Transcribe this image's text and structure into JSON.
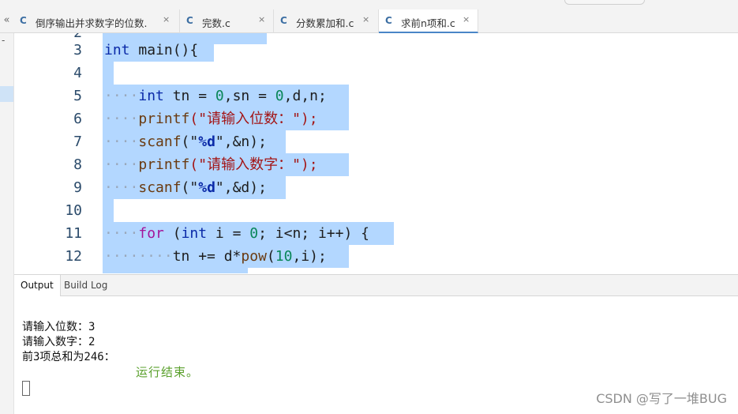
{
  "tabs": [
    {
      "icon": "C",
      "label": "倒序输出并求数字的位数.",
      "close": "×",
      "active": false
    },
    {
      "icon": "C",
      "label": "完数.c",
      "close": "×",
      "active": false
    },
    {
      "icon": "C",
      "label": "分数累加和.c",
      "close": "×",
      "active": false
    },
    {
      "icon": "C",
      "label": "求前n项和.c",
      "close": "×",
      "active": true
    }
  ],
  "sidebar": {
    "collapse_label": "«",
    "dash_label": "-"
  },
  "editor": {
    "lines": [
      {
        "num": "2"
      },
      {
        "num": "3"
      },
      {
        "num": "4"
      },
      {
        "num": "5"
      },
      {
        "num": "6"
      },
      {
        "num": "7"
      },
      {
        "num": "8"
      },
      {
        "num": "9"
      },
      {
        "num": "10"
      },
      {
        "num": "11"
      },
      {
        "num": "12"
      }
    ],
    "code": {
      "l3": {
        "kw": "int",
        "rest": " main(){"
      },
      "l5": {
        "kw": "int",
        "a": " tn = ",
        "n1": "0",
        "b": ",sn = ",
        "n2": "0",
        "c": ",d,n;"
      },
      "l6": {
        "fn": "printf",
        "s": "(\"请输入位数：\");"
      },
      "l7": {
        "fn": "scanf",
        "a": "(\"",
        "fmt": "%d",
        "b": "\",&n);"
      },
      "l8": {
        "fn": "printf",
        "s": "(\"请输入数字：\");"
      },
      "l9": {
        "fn": "scanf",
        "a": "(\"",
        "fmt": "%d",
        "b": "\",&d);"
      },
      "l11": {
        "kw2": "for",
        "a": " (",
        "kw": "int",
        "b": " i = ",
        "n": "0",
        "c": "; i<n; i++) {"
      },
      "l12": {
        "a": "tn += d*",
        "fn": "pow",
        "b": "(",
        "n": "10",
        "c": ",i);"
      }
    }
  },
  "output_panel": {
    "tabs": [
      "Output",
      "Build Log"
    ],
    "lines": [
      "请输入位数：3",
      "请输入数字：2",
      "前3项总和为246："
    ],
    "run_end": "运行结束。"
  },
  "watermark": "CSDN @写了一堆BUG"
}
